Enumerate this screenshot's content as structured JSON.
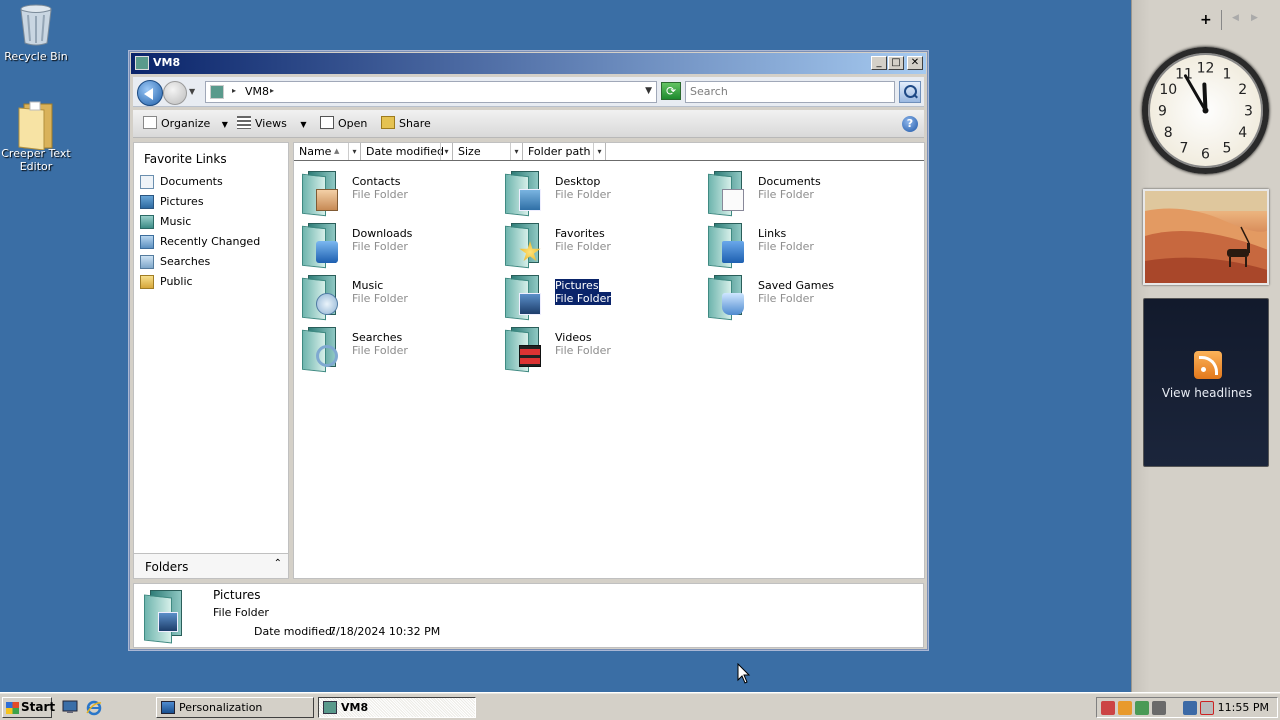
{
  "desktop": {
    "icons": [
      {
        "label": "Recycle Bin",
        "icon": "recycle-bin-icon"
      },
      {
        "label": "Creeper Text Editor",
        "icon": "folder-icon"
      }
    ]
  },
  "window": {
    "title": "VM8",
    "title_icon": "computer-folder-icon",
    "controls": {
      "minimize": "_",
      "maximize": "□",
      "close": "✕"
    },
    "address": {
      "crumb": "VM8",
      "separator": "▸",
      "history_arrow": "▼",
      "search_placeholder": "Search"
    },
    "toolbar": {
      "organize": "Organize",
      "views": "Views",
      "open": "Open",
      "share": "Share",
      "dropdown_arrow": "▼",
      "help": "?"
    },
    "nav_pane": {
      "heading": "Favorite Links",
      "links": [
        {
          "label": "Documents",
          "icon": "documents-icon"
        },
        {
          "label": "Pictures",
          "icon": "pictures-icon"
        },
        {
          "label": "Music",
          "icon": "music-icon"
        },
        {
          "label": "Recently Changed",
          "icon": "recently-changed-icon"
        },
        {
          "label": "Searches",
          "icon": "searches-icon"
        },
        {
          "label": "Public",
          "icon": "public-folder-icon"
        }
      ],
      "folders_label": "Folders",
      "folders_chevron": "⌃"
    },
    "columns": [
      {
        "label": "Name",
        "sort": "▲"
      },
      {
        "label": "Date modified"
      },
      {
        "label": "Size"
      },
      {
        "label": "Folder path"
      }
    ],
    "column_arrow": "▾",
    "items": [
      {
        "name": "Contacts",
        "type": "File Folder",
        "icon": "contacts-folder-icon",
        "selected": false
      },
      {
        "name": "Desktop",
        "type": "File Folder",
        "icon": "desktop-folder-icon",
        "selected": false
      },
      {
        "name": "Documents",
        "type": "File Folder",
        "icon": "documents-folder-icon",
        "selected": false
      },
      {
        "name": "Downloads",
        "type": "File Folder",
        "icon": "downloads-folder-icon",
        "selected": false
      },
      {
        "name": "Favorites",
        "type": "File Folder",
        "icon": "favorites-folder-icon",
        "selected": false
      },
      {
        "name": "Links",
        "type": "File Folder",
        "icon": "links-folder-icon",
        "selected": false
      },
      {
        "name": "Music",
        "type": "File Folder",
        "icon": "music-folder-icon",
        "selected": false
      },
      {
        "name": "Pictures",
        "type": "File Folder",
        "icon": "pictures-folder-icon",
        "selected": true
      },
      {
        "name": "Saved Games",
        "type": "File Folder",
        "icon": "saved-games-folder-icon",
        "selected": false
      },
      {
        "name": "Searches",
        "type": "File Folder",
        "icon": "searches-folder-icon",
        "selected": false
      },
      {
        "name": "Videos",
        "type": "File Folder",
        "icon": "videos-folder-icon",
        "selected": false
      }
    ],
    "details": {
      "name": "Pictures",
      "type": "File Folder",
      "modified_label": "Date modified:",
      "modified_value": "7/18/2024 10:32 PM"
    }
  },
  "sidebar": {
    "add_gadget": "+",
    "prev": "◀",
    "next": "▶",
    "clock": {
      "hour": 11,
      "minute": 55,
      "numerals": [
        "12",
        "1",
        "2",
        "3",
        "4",
        "5",
        "6",
        "7",
        "8",
        "9",
        "10",
        "11"
      ]
    },
    "slideshow": {
      "icon": "desert-oryx-photo"
    },
    "feed": {
      "label": "View headlines",
      "icon": "rss-icon"
    }
  },
  "taskbar": {
    "start_label": "Start",
    "quick_launch": [
      {
        "icon": "show-desktop-icon"
      },
      {
        "icon": "internet-explorer-icon"
      }
    ],
    "tasks": [
      {
        "label": "Personalization",
        "icon": "personalization-icon",
        "active": false
      },
      {
        "label": "VM8",
        "icon": "computer-folder-icon",
        "active": true
      }
    ],
    "tray_time": "11:55 PM"
  },
  "colors": {
    "desktop": "#3a6ea5",
    "title_gradient_start": "#0a246a",
    "title_gradient_end": "#a6caf0",
    "selection": "#0a246a"
  }
}
